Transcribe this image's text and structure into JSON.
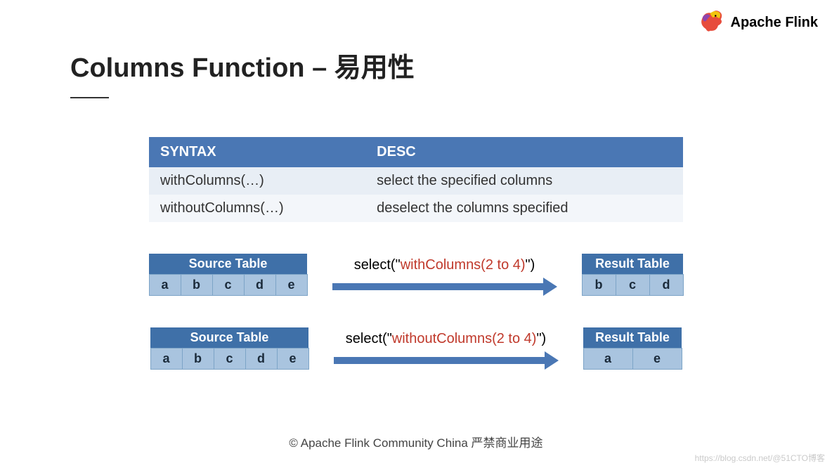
{
  "brand": "Apache Flink",
  "title": "Columns Function – 易用性",
  "syntax_table": {
    "headers": [
      "SYNTAX",
      "DESC"
    ],
    "rows": [
      {
        "syntax": "withColumns(…)",
        "desc": "select the specified columns"
      },
      {
        "syntax": "withoutColumns(…)",
        "desc": "deselect the columns specified"
      }
    ]
  },
  "flows": [
    {
      "source_title": "Source Table",
      "source_cols": [
        "a",
        "b",
        "c",
        "d",
        "e"
      ],
      "label_prefix": "select(\"",
      "label_red": "withColumns(2 to 4)",
      "label_suffix": "\")",
      "result_title": "Result Table",
      "result_cols": [
        "b",
        "c",
        "d"
      ]
    },
    {
      "source_title": "Source Table",
      "source_cols": [
        "a",
        "b",
        "c",
        "d",
        "e"
      ],
      "label_prefix": "select(\"",
      "label_red": "withoutColumns(2 to 4)",
      "label_suffix": "\")",
      "result_title": "Result Table",
      "result_cols": [
        "a",
        "e"
      ]
    }
  ],
  "footer": "© Apache Flink Community China  严禁商业用途",
  "watermark": "https://blog.csdn.net/@51CTO博客"
}
